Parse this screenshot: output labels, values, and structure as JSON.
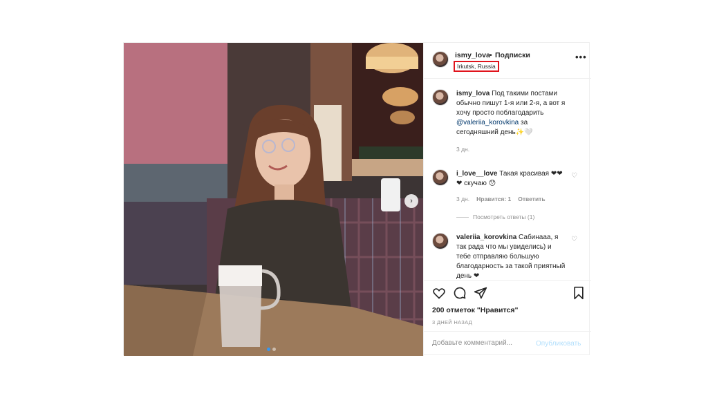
{
  "post": {
    "author": {
      "username": "ismy_lova",
      "separator": "•",
      "follow_label": "Подписки",
      "location": "Irkutsk, Russia",
      "more_label": "•••"
    },
    "caption": {
      "username": "ismy_lova",
      "text_before": " Под такими постами обычно пишут 1-я или 2-я, а вот я хочу просто поблагодарить ",
      "mention": "@valeriia_korovkina",
      "text_after": " за сегодняшний день✨🤍",
      "time": "3 дн."
    },
    "comments": [
      {
        "username": "i_love__love",
        "text": " Такая красивая ❤❤ ❤ скучаю 😯",
        "time": "3 дн.",
        "likes": "Нравится: 1",
        "reply": "Ответить",
        "view_replies": "Посмотреть ответы (1)"
      },
      {
        "username": "valeriia_korovkina",
        "text": " Сабинааа, я так рада что мы увиделись) и тебе отправляю большую благодарность за такой приятный день ❤"
      }
    ],
    "likes_count": "200 отметок \"Нравится\"",
    "date": "3 ДНЕЙ НАЗАД",
    "comment_placeholder": "Добавьте комментарий...",
    "publish_label": "Опубликовать",
    "next_arrow": "›",
    "carousel": {
      "total": 2,
      "current": 1
    }
  },
  "icons": [
    "like-icon",
    "comment-icon",
    "share-icon",
    "bookmark-icon",
    "more-icon",
    "heart-icon"
  ],
  "colors": {
    "accent_blue": "#3897f0",
    "location_highlight": "#e0141c",
    "mention": "#00376b",
    "muted": "#8e8e8e"
  }
}
